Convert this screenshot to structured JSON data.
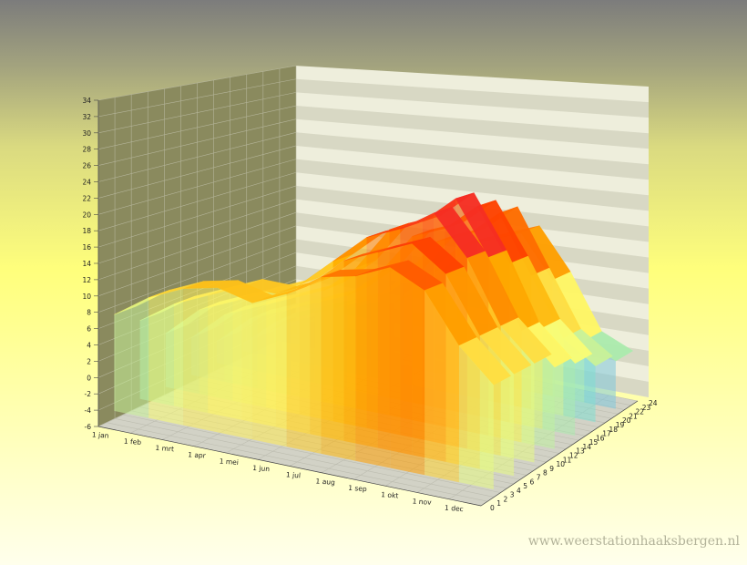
{
  "chart_data": {
    "type": "surface",
    "title": "",
    "xlabel": "",
    "ylabel": "",
    "zlabel": "",
    "x_ticks": [
      "1 jan",
      "1 feb",
      "1 mrt",
      "1 apr",
      "1 mei",
      "1 jun",
      "1 jul",
      "1 aug",
      "1 sep",
      "1 okt",
      "1 nov",
      "1 dec"
    ],
    "y_ticks": [
      0,
      1,
      2,
      3,
      4,
      5,
      6,
      7,
      8,
      9,
      10,
      11,
      12,
      13,
      14,
      15,
      16,
      17,
      18,
      19,
      20,
      21,
      22,
      23,
      24
    ],
    "z_ticks": [
      -6,
      -4,
      -2,
      0,
      2,
      4,
      6,
      8,
      10,
      12,
      14,
      16,
      18,
      20,
      22,
      24,
      26,
      28,
      30,
      32,
      34
    ],
    "zlim": [
      -6,
      34
    ],
    "grid": true,
    "series": [
      {
        "values": [
          7,
          10,
          12,
          13,
          12,
          14,
          17,
          18,
          20,
          18,
          12,
          8
        ]
      },
      {
        "values": [
          5,
          8,
          10,
          12,
          12,
          14,
          18,
          20,
          22,
          19,
          12,
          8
        ]
      },
      {
        "values": [
          2,
          6,
          8,
          10,
          12,
          16,
          20,
          22,
          25,
          20,
          12,
          8
        ]
      },
      {
        "values": [
          0,
          4,
          6,
          8,
          10,
          14,
          20,
          22,
          26,
          19,
          10,
          6
        ]
      },
      {
        "values": [
          -2,
          2,
          4,
          6,
          8,
          12,
          18,
          20,
          24,
          17,
          9,
          5
        ]
      },
      {
        "values": [
          -4,
          0,
          2,
          4,
          6,
          10,
          16,
          18,
          22,
          14,
          6,
          3
        ]
      },
      {
        "values": [
          -4,
          -2,
          0,
          2,
          4,
          9,
          14,
          16,
          18,
          12,
          4,
          2
        ]
      }
    ],
    "colors": {
      "scale": [
        "#8080ff",
        "#80e0d0",
        "#ffff70",
        "#ffb000",
        "#ff4000",
        "#e0007a",
        "#9a5cff"
      ],
      "left_wall": "#8a8a5e",
      "back_wall": "#eeeedc",
      "floor": "#d2d2c6"
    }
  },
  "watermark": "www.weerstationhaaksbergen.nl"
}
